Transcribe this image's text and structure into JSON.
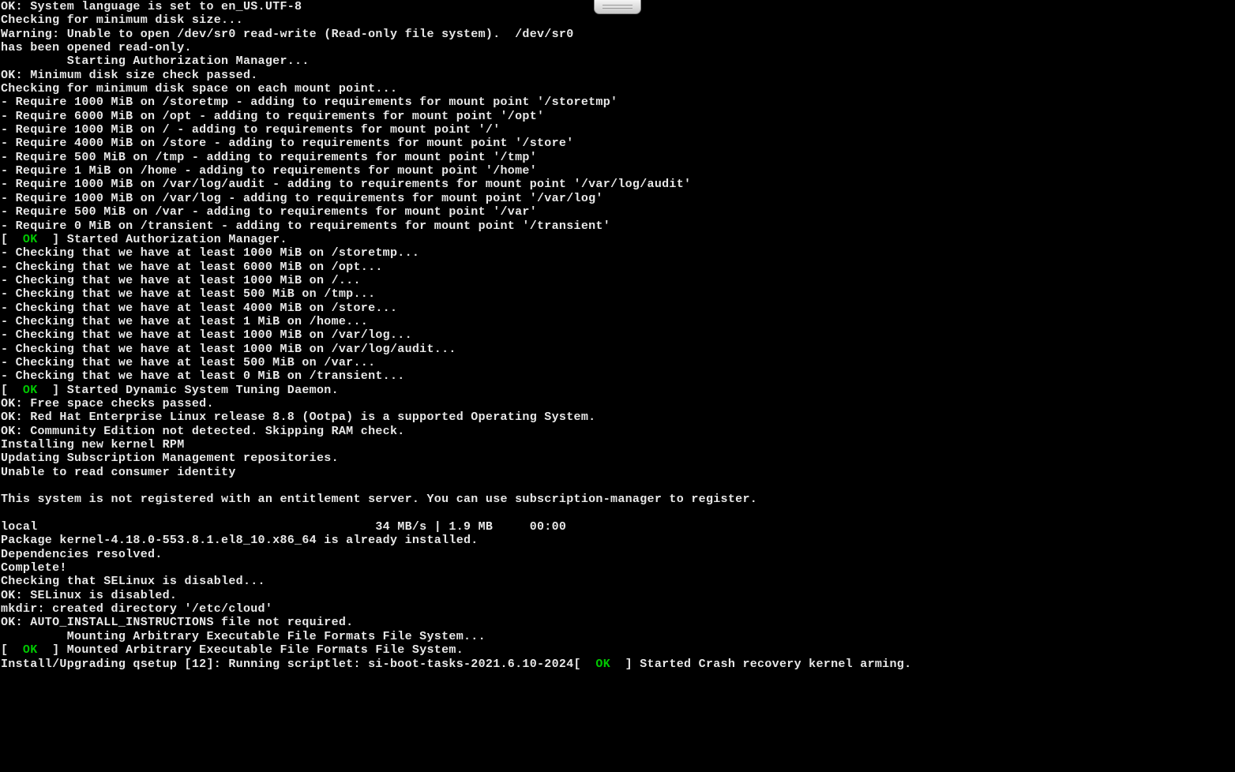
{
  "lines": [
    {
      "parts": [
        {
          "t": "OK: System language is set to en_US.UTF-8"
        }
      ]
    },
    {
      "parts": [
        {
          "t": "Checking for minimum disk size..."
        }
      ]
    },
    {
      "parts": [
        {
          "t": "Warning: Unable to open /dev/sr0 read-write (Read-only file system).  /dev/sr0"
        }
      ]
    },
    {
      "parts": [
        {
          "t": "has been opened read-only."
        }
      ]
    },
    {
      "parts": [
        {
          "t": "         Starting Authorization Manager..."
        }
      ]
    },
    {
      "parts": [
        {
          "t": "OK: Minimum disk size check passed."
        }
      ]
    },
    {
      "parts": [
        {
          "t": "Checking for minimum disk space on each mount point..."
        }
      ]
    },
    {
      "parts": [
        {
          "t": "- Require 1000 MiB on /storetmp - adding to requirements for mount point '/storetmp'"
        }
      ]
    },
    {
      "parts": [
        {
          "t": "- Require 6000 MiB on /opt - adding to requirements for mount point '/opt'"
        }
      ]
    },
    {
      "parts": [
        {
          "t": "- Require 1000 MiB on / - adding to requirements for mount point '/'"
        }
      ]
    },
    {
      "parts": [
        {
          "t": "- Require 4000 MiB on /store - adding to requirements for mount point '/store'"
        }
      ]
    },
    {
      "parts": [
        {
          "t": "- Require 500 MiB on /tmp - adding to requirements for mount point '/tmp'"
        }
      ]
    },
    {
      "parts": [
        {
          "t": "- Require 1 MiB on /home - adding to requirements for mount point '/home'"
        }
      ]
    },
    {
      "parts": [
        {
          "t": "- Require 1000 MiB on /var/log/audit - adding to requirements for mount point '/var/log/audit'"
        }
      ]
    },
    {
      "parts": [
        {
          "t": "- Require 1000 MiB on /var/log - adding to requirements for mount point '/var/log'"
        }
      ]
    },
    {
      "parts": [
        {
          "t": "- Require 500 MiB on /var - adding to requirements for mount point '/var'"
        }
      ]
    },
    {
      "parts": [
        {
          "t": "- Require 0 MiB on /transient - adding to requirements for mount point '/transient'"
        }
      ]
    },
    {
      "parts": [
        {
          "t": "[  "
        },
        {
          "t": "OK",
          "c": "ok"
        },
        {
          "t": "  ] Started Authorization Manager."
        }
      ]
    },
    {
      "parts": [
        {
          "t": "- Checking that we have at least 1000 MiB on /storetmp..."
        }
      ]
    },
    {
      "parts": [
        {
          "t": "- Checking that we have at least 6000 MiB on /opt..."
        }
      ]
    },
    {
      "parts": [
        {
          "t": "- Checking that we have at least 1000 MiB on /..."
        }
      ]
    },
    {
      "parts": [
        {
          "t": "- Checking that we have at least 500 MiB on /tmp..."
        }
      ]
    },
    {
      "parts": [
        {
          "t": "- Checking that we have at least 4000 MiB on /store..."
        }
      ]
    },
    {
      "parts": [
        {
          "t": "- Checking that we have at least 1 MiB on /home..."
        }
      ]
    },
    {
      "parts": [
        {
          "t": "- Checking that we have at least 1000 MiB on /var/log..."
        }
      ]
    },
    {
      "parts": [
        {
          "t": "- Checking that we have at least 1000 MiB on /var/log/audit..."
        }
      ]
    },
    {
      "parts": [
        {
          "t": "- Checking that we have at least 500 MiB on /var..."
        }
      ]
    },
    {
      "parts": [
        {
          "t": "- Checking that we have at least 0 MiB on /transient..."
        }
      ]
    },
    {
      "parts": [
        {
          "t": "[  "
        },
        {
          "t": "OK",
          "c": "ok"
        },
        {
          "t": "  ] Started Dynamic System Tuning Daemon."
        }
      ]
    },
    {
      "parts": [
        {
          "t": "OK: Free space checks passed."
        }
      ]
    },
    {
      "parts": [
        {
          "t": "OK: Red Hat Enterprise Linux release 8.8 (Ootpa) is a supported Operating System."
        }
      ]
    },
    {
      "parts": [
        {
          "t": "OK: Community Edition not detected. Skipping RAM check."
        }
      ]
    },
    {
      "parts": [
        {
          "t": "Installing new kernel RPM"
        }
      ]
    },
    {
      "parts": [
        {
          "t": "Updating Subscription Management repositories."
        }
      ]
    },
    {
      "parts": [
        {
          "t": "Unable to read consumer identity"
        }
      ]
    },
    {
      "parts": [
        {
          "t": ""
        }
      ]
    },
    {
      "parts": [
        {
          "t": "This system is not registered with an entitlement server. You can use subscription-manager to register."
        }
      ]
    },
    {
      "parts": [
        {
          "t": ""
        }
      ]
    },
    {
      "parts": [
        {
          "t": "local                                              34 MB/s | 1.9 MB     00:00"
        }
      ]
    },
    {
      "parts": [
        {
          "t": "Package kernel-4.18.0-553.8.1.el8_10.x86_64 is already installed."
        }
      ]
    },
    {
      "parts": [
        {
          "t": "Dependencies resolved."
        }
      ]
    },
    {
      "parts": [
        {
          "t": "Complete!"
        }
      ]
    },
    {
      "parts": [
        {
          "t": "Checking that SELinux is disabled..."
        }
      ]
    },
    {
      "parts": [
        {
          "t": "OK: SELinux is disabled."
        }
      ]
    },
    {
      "parts": [
        {
          "t": "mkdir: created directory '/etc/cloud'"
        }
      ]
    },
    {
      "parts": [
        {
          "t": "OK: AUTO_INSTALL_INSTRUCTIONS file not required."
        }
      ]
    },
    {
      "parts": [
        {
          "t": "         Mounting Arbitrary Executable File Formats File System..."
        }
      ]
    },
    {
      "parts": [
        {
          "t": "[  "
        },
        {
          "t": "OK",
          "c": "ok"
        },
        {
          "t": "  ] Mounted Arbitrary Executable File Formats File System."
        }
      ]
    },
    {
      "parts": [
        {
          "t": "Install/Upgrading qsetup [12]: Running scriptlet: si-boot-tasks-2021.6.10-2024[  "
        },
        {
          "t": "OK",
          "c": "ok"
        },
        {
          "t": "  ] Started Crash recovery kernel arming."
        }
      ]
    }
  ]
}
